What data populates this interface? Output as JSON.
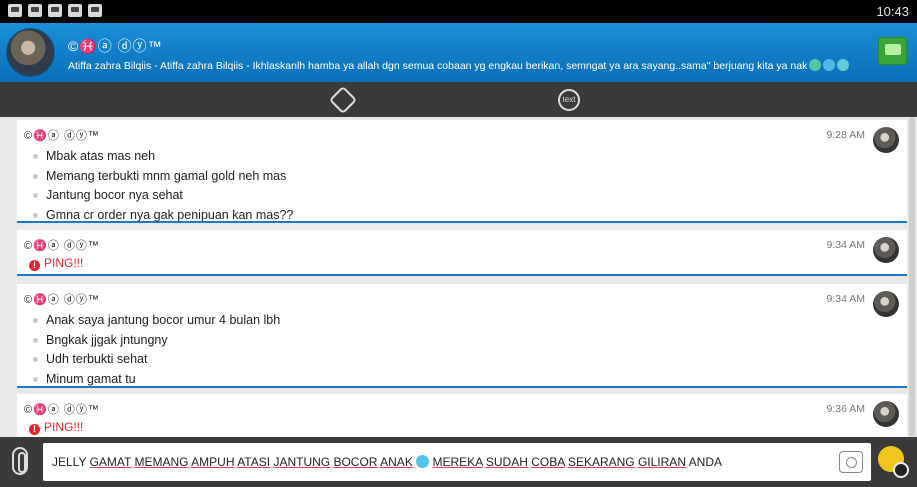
{
  "statusbar": {
    "clock": "10:43",
    "notification_icons": [
      "messenger-icon",
      "messenger-icon",
      "voicemail-icon",
      "chat-icon",
      "chat-icon"
    ]
  },
  "header": {
    "contact_name": "©♓ⓐ ⓓⓨ™",
    "status_message": "Atiffa zahra Bilqiis - Atiffa zahra Bilqiis - Ikhlaskanlh hamba ya allah dgn semua cobaan yg engkau berikan, semngat ya ara sayang..sama\" berjuang kita ya nak",
    "colors": {
      "header_top": "#1a8fd8",
      "header_bottom": "#0a6fb8",
      "accent_line": "#1a7bc4"
    }
  },
  "toolbar": {
    "text_tool_label": "text"
  },
  "messages": [
    {
      "sender_prefix": "©",
      "sender_symbol": "♓",
      "sender_rest": "ⓐ ⓓⓨ™",
      "time": "9:28 AM",
      "lines": [
        "Mbak atas mas neh",
        "Memang terbukti mnm gamal gold neh mas",
        "Jantung bocor nya sehat",
        "Gmna cr order nya gak penipuan kan mas??"
      ]
    },
    {
      "sender_prefix": "©",
      "sender_symbol": "♓",
      "sender_rest": "ⓐ ⓓⓨ™",
      "time": "9:34 AM",
      "ping": "PING!!!"
    },
    {
      "sender_prefix": "©",
      "sender_symbol": "♓",
      "sender_rest": "ⓐ ⓓⓨ™",
      "time": "9:34 AM",
      "lines": [
        "Anak saya jantung bocor umur 4 bulan lbh",
        "Bngkak jjgak jntungny",
        "Udh terbukti sehat",
        "Minum gamat tu"
      ]
    },
    {
      "sender_prefix": "©",
      "sender_symbol": "♓",
      "sender_rest": "ⓐ ⓓⓨ™",
      "time": "9:36 AM",
      "ping": "PING!!!"
    }
  ],
  "composer": {
    "words_before_emoji": [
      "JELLY",
      "GAMAT",
      "MEMANG",
      "AMPUH",
      "ATASI",
      "JANTUNG",
      "BOCOR",
      "ANAK"
    ],
    "words_after_emoji": [
      "MEREKA",
      "SUDAH",
      "COBA",
      "SEKARANG",
      "GILIRAN",
      "ANDA"
    ]
  }
}
